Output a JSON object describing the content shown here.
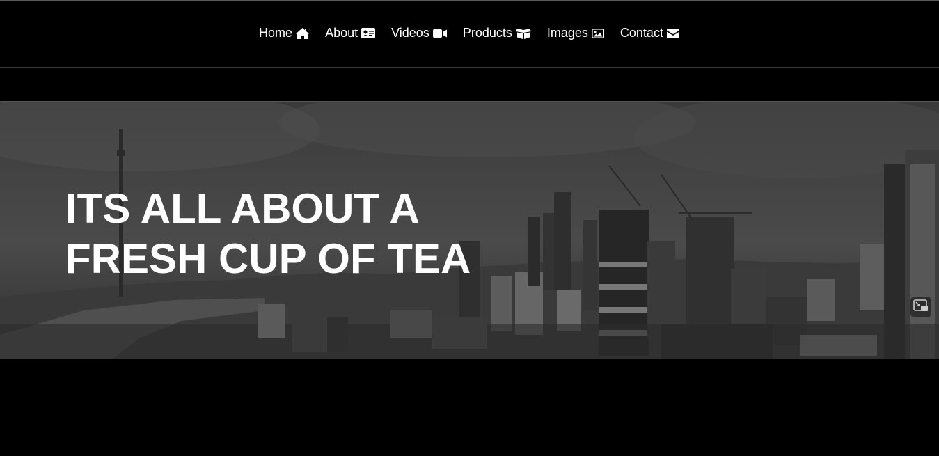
{
  "nav": {
    "items": [
      {
        "label": "Home",
        "icon": "home-icon"
      },
      {
        "label": "About",
        "icon": "id-card-icon"
      },
      {
        "label": "Videos",
        "icon": "video-camera-icon"
      },
      {
        "label": "Products",
        "icon": "boxes-icon"
      },
      {
        "label": "Images",
        "icon": "image-icon"
      },
      {
        "label": "Contact",
        "icon": "envelope-icon"
      }
    ]
  },
  "hero": {
    "title": "ITS ALL ABOUT A FRESH CUP OF TEA",
    "pip_icon": "picture-in-picture-icon"
  },
  "colors": {
    "background": "#000000",
    "text": "#ffffff",
    "hero_overlay": "#444444"
  }
}
